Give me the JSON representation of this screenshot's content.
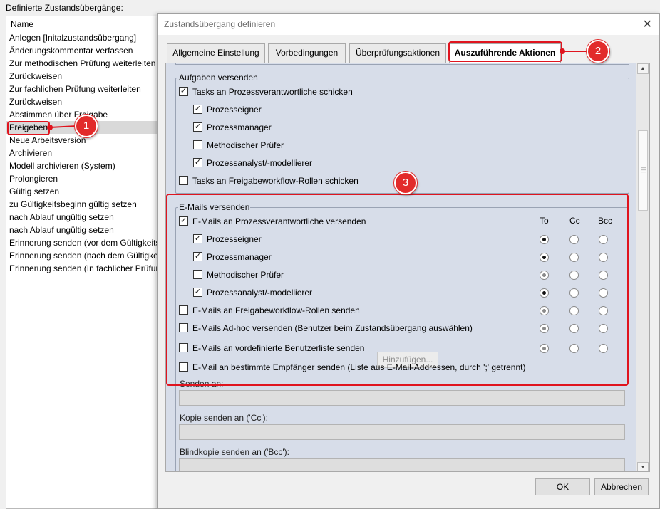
{
  "background": {
    "title": "Definierte Zustandsübergänge:",
    "column_header": "Name",
    "items": [
      "Anlegen [Initalzustandsübergang]",
      "Änderungskommentar verfassen",
      "Zur methodischen Prüfung weiterleiten",
      "Zurückweisen",
      "Zur fachlichen Prüfung weiterleiten",
      "Zurückweisen",
      "Abstimmen über Freigabe",
      "Freigeben",
      "Neue Arbeitsversion",
      "Archivieren",
      "Modell archivieren (System)",
      "Prolongieren",
      "Gültig setzen",
      "zu Gültigkeitsbeginn gültig setzen",
      "nach Ablauf ungültig setzen",
      "nach Ablauf ungültig setzen",
      "Erinnerung senden (vor dem Gültigkeitsende)",
      "Erinnerung senden (nach dem Gültigkeitsende)",
      "Erinnerung senden (In fachlicher Prüfung)"
    ],
    "selected_index": 7
  },
  "dialog": {
    "title": "Zustandsübergang definieren",
    "close_glyph": "✕",
    "tabs": [
      "Allgemeine Einstellung",
      "Vorbedingungen",
      "Überprüfungsaktionen",
      "Auszuführende Aktionen"
    ],
    "active_tab": 3,
    "ok_label": "OK",
    "cancel_label": "Abbrechen"
  },
  "tasks_group": {
    "legend": "Aufgaben versenden",
    "items": [
      {
        "label": "Tasks an Prozessverantwortliche schicken",
        "checked": true
      },
      {
        "label": "Prozesseigner",
        "checked": true
      },
      {
        "label": "Prozessmanager",
        "checked": true
      },
      {
        "label": "Methodischer Prüfer",
        "checked": false
      },
      {
        "label": "Prozessanalyst/-modellierer",
        "checked": true
      },
      {
        "label": "Tasks an Freigabeworkflow-Rollen schicken",
        "checked": false
      }
    ]
  },
  "email_group": {
    "legend": "E-Mails versenden",
    "columns": [
      "To",
      "Cc",
      "Bcc"
    ],
    "items": [
      {
        "label": "E-Mails an Prozessverantwortliche versenden",
        "checked": true
      },
      {
        "label": "Prozesseigner",
        "checked": true,
        "recipient": "To"
      },
      {
        "label": "Prozessmanager",
        "checked": true,
        "recipient": "To"
      },
      {
        "label": "Methodischer Prüfer",
        "checked": false,
        "recipient": "To"
      },
      {
        "label": "Prozessanalyst/-modellierer",
        "checked": true,
        "recipient": "To"
      },
      {
        "label": "E-Mails an Freigabeworkflow-Rollen senden",
        "checked": false,
        "recipient": "To"
      },
      {
        "label": "E-Mails Ad-hoc versenden (Benutzer beim Zustandsübergang auswählen)",
        "checked": false,
        "recipient": "To"
      },
      {
        "label": "E-Mails an vordefinierte Benutzerliste senden",
        "checked": false,
        "recipient": "To"
      },
      {
        "label": "E-Mail an bestimmte Empfänger senden (Liste aus E-Mail-Addressen, durch ';' getrennt)",
        "checked": false
      }
    ],
    "add_button": "Hinzufügen...",
    "send_to_label": "Senden an:",
    "cc_label": "Kopie senden an ('Cc'):",
    "bcc_label": "Blindkopie senden an ('Bcc'):",
    "send_to_value": "",
    "cc_value": "",
    "bcc_value": ""
  },
  "annotations": {
    "marker_1": "1",
    "marker_2": "2",
    "marker_3": "3",
    "color": "#e0141e"
  },
  "icons": {
    "check_glyph": "✓",
    "scroll_up": "▲",
    "scroll_down": "▼"
  }
}
